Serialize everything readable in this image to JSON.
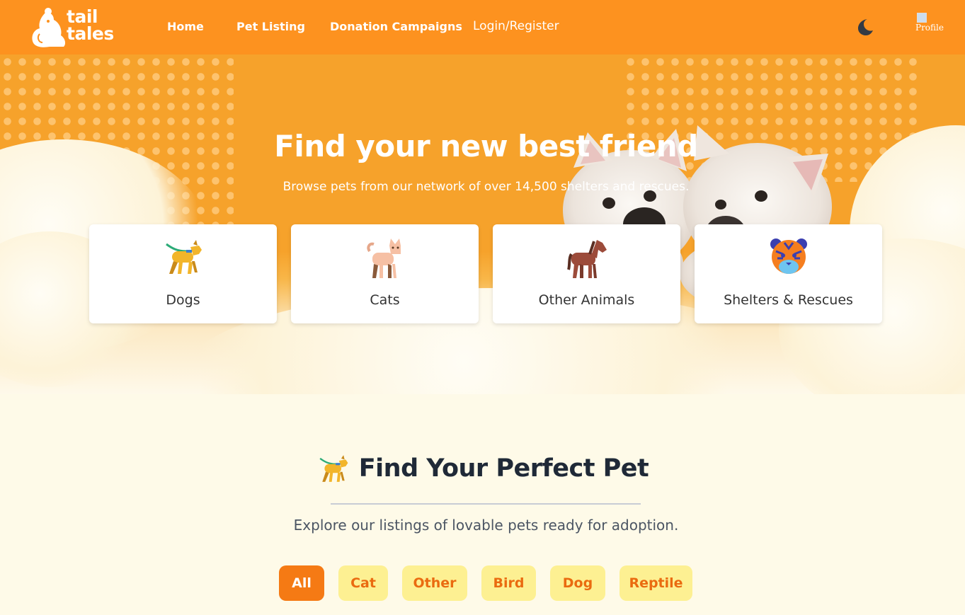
{
  "brand": {
    "line1": "tail",
    "line2": "tales"
  },
  "nav": {
    "home": "Home",
    "pet_listing": "Pet Listing",
    "donation_campaigns": "Donation Campaigns",
    "login_register": "Login/Register",
    "profile_alt": "Profile"
  },
  "hero": {
    "title": "Find your new best friend",
    "subtitle": "Browse pets from our network of over 14,500 shelters and rescues."
  },
  "categories": [
    {
      "label": "Dogs",
      "icon": "dog-icon"
    },
    {
      "label": "Cats",
      "icon": "cat-icon"
    },
    {
      "label": "Other Animals",
      "icon": "horse-icon"
    },
    {
      "label": "Shelters & Rescues",
      "icon": "tiger-icon"
    }
  ],
  "section": {
    "title": "Find Your Perfect Pet",
    "subtitle": "Explore our listings of lovable pets ready for adoption."
  },
  "filters": [
    {
      "label": "All",
      "active": true
    },
    {
      "label": "Cat",
      "active": false
    },
    {
      "label": "Other",
      "active": false
    },
    {
      "label": "Bird",
      "active": false
    },
    {
      "label": "Dog",
      "active": false
    },
    {
      "label": "Reptile",
      "active": false
    }
  ],
  "colors": {
    "navbar": "#fd921f",
    "hero": "#f6a22b",
    "filter_active": "#f57a14",
    "filter_inactive": "#fdf092",
    "filter_text": "#ea6b10"
  }
}
